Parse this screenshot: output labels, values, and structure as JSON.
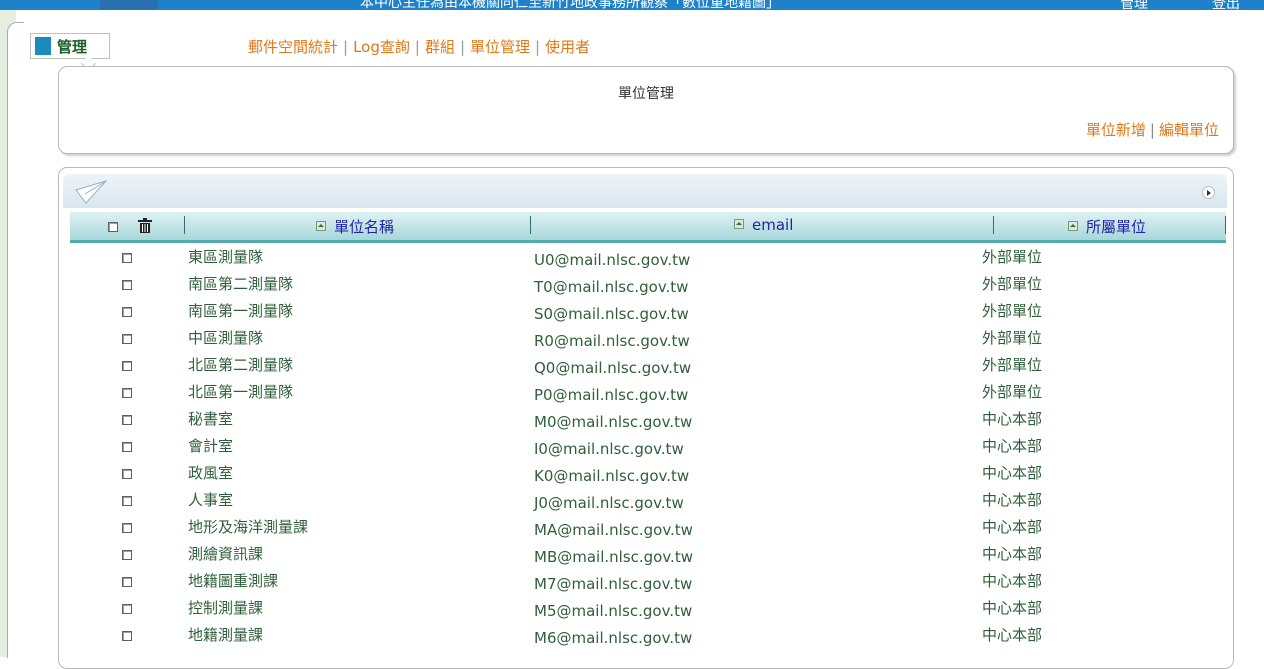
{
  "header": {
    "title": "本中心主任為由本機關同仁至新竹地政事務所觀察「數位重地籍圖」",
    "admin_label": "管理",
    "logout_label": "登出"
  },
  "manage_tab": {
    "label": "管理"
  },
  "nav": {
    "items": [
      "郵件空間統計",
      "Log查詢",
      "群組",
      "單位管理",
      "使用者"
    ],
    "separator": "|"
  },
  "panel": {
    "title": "單位管理",
    "actions": [
      "單位新增",
      "編輯單位"
    ],
    "separator": "|"
  },
  "table": {
    "columns": [
      "單位名稱",
      "email",
      "所屬單位"
    ],
    "rows": [
      {
        "name": "東區測量隊",
        "email": "U0@mail.nlsc.gov.tw",
        "unit": "外部單位"
      },
      {
        "name": "南區第二測量隊",
        "email": "T0@mail.nlsc.gov.tw",
        "unit": "外部單位"
      },
      {
        "name": "南區第一測量隊",
        "email": "S0@mail.nlsc.gov.tw",
        "unit": "外部單位"
      },
      {
        "name": "中區測量隊",
        "email": "R0@mail.nlsc.gov.tw",
        "unit": "外部單位"
      },
      {
        "name": "北區第二測量隊",
        "email": "Q0@mail.nlsc.gov.tw",
        "unit": "外部單位"
      },
      {
        "name": "北區第一測量隊",
        "email": "P0@mail.nlsc.gov.tw",
        "unit": "外部單位"
      },
      {
        "name": "秘書室",
        "email": "M0@mail.nlsc.gov.tw",
        "unit": "中心本部"
      },
      {
        "name": "會計室",
        "email": "I0@mail.nlsc.gov.tw",
        "unit": "中心本部"
      },
      {
        "name": "政風室",
        "email": "K0@mail.nlsc.gov.tw",
        "unit": "中心本部"
      },
      {
        "name": "人事室",
        "email": "J0@mail.nlsc.gov.tw",
        "unit": "中心本部"
      },
      {
        "name": "地形及海洋測量課",
        "email": "MA@mail.nlsc.gov.tw",
        "unit": "中心本部"
      },
      {
        "name": "測繪資訊課",
        "email": "MB@mail.nlsc.gov.tw",
        "unit": "中心本部"
      },
      {
        "name": "地籍圖重測課",
        "email": "M7@mail.nlsc.gov.tw",
        "unit": "中心本部"
      },
      {
        "name": "控制測量課",
        "email": "M5@mail.nlsc.gov.tw",
        "unit": "中心本部"
      },
      {
        "name": "地籍測量課",
        "email": "M6@mail.nlsc.gov.tw",
        "unit": "中心本部"
      }
    ]
  },
  "colors": {
    "accent_orange": "#e0781a",
    "header_blue": "#1f82c8",
    "text_green": "#2f5f3a",
    "table_header_teal": "#a8d7da"
  }
}
